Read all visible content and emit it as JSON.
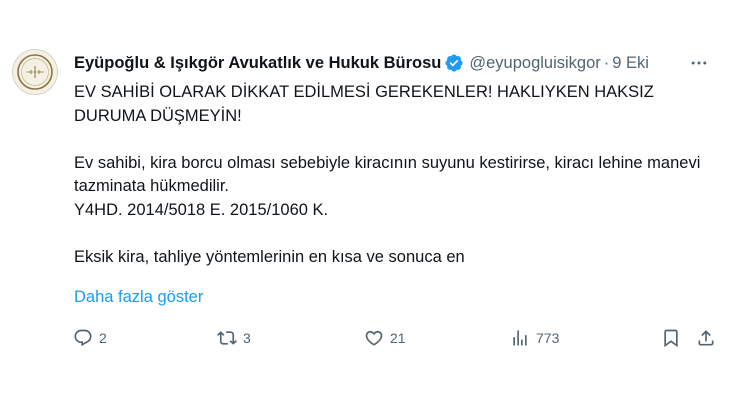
{
  "tweet": {
    "author": {
      "display_name": "Eyüpoğlu & Işıkgör Avukatlık ve Hukuk Bürosu",
      "handle": "@eyupogluisikgor",
      "verified": true
    },
    "separator": "·",
    "time": "9 Eki",
    "text": {
      "line1": "EV SAHİBİ OLARAK DİKKAT EDİLMESİ GEREKENLER! HAKLIYKEN HAKSIZ DURUMA DÜŞMEYİN!",
      "line2": "Ev sahibi, kira borcu olması sebebiyle kiracının suyunu kestirirse, kiracı lehine manevi tazminata hükmedilir.",
      "line3": "Y4HD. 2014/5018 E. 2015/1060 K.",
      "line4": "Eksik kira, tahliye yöntemlerinin en kısa ve sonuca en"
    },
    "show_more": "Daha fazla göster",
    "metrics": {
      "replies": "2",
      "retweets": "3",
      "likes": "21",
      "views": "773"
    }
  },
  "icons": {
    "more": "more-horizontal-icon",
    "verified": "verified-badge-icon",
    "reply": "reply-icon",
    "retweet": "retweet-icon",
    "like": "heart-icon",
    "views": "analytics-icon",
    "bookmark": "bookmark-icon",
    "share": "share-icon"
  },
  "colors": {
    "text": "#0f1419",
    "secondary": "#536471",
    "link": "#1d9bf0",
    "verified": "#1d9bf0"
  }
}
